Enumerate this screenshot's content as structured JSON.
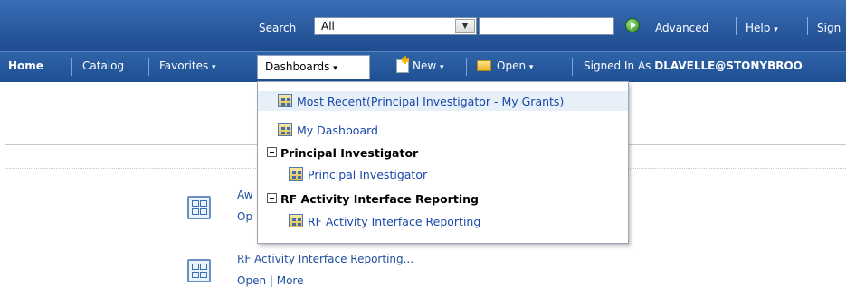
{
  "topbar": {
    "search_label": "Search",
    "search_scope": "All",
    "search_input_value": "",
    "advanced_label": "Advanced",
    "help_label": "Help",
    "sign_label": "Sign"
  },
  "nav": {
    "home": "Home",
    "catalog": "Catalog",
    "favorites": "Favorites",
    "dashboards": "Dashboards",
    "new": "New",
    "open": "Open",
    "signed_in_as": "Signed In As",
    "user": "DLAVELLE@STONYBROO"
  },
  "dashboards_menu": {
    "most_recent": "Most Recent(Principal Investigator - My Grants)",
    "my_dashboard": "My Dashboard",
    "groups": [
      {
        "heading": "Principal Investigator",
        "items": [
          "Principal Investigator"
        ]
      },
      {
        "heading": "RF Activity Interface Reporting",
        "items": [
          "RF Activity Interface Reporting"
        ]
      }
    ]
  },
  "content": {
    "item1_title_partial": "Aw",
    "item1_links_partial": "Op",
    "item2_title": "RF Activity Interface Reporting...",
    "item2_links": "Open | More"
  },
  "icons": {
    "go": "go-arrow-icon",
    "dashboard": "dashboard-icon",
    "new": "new-icon",
    "open": "folder-icon",
    "dropdown": "chevron-down-icon",
    "collapse": "collapse-minus-icon"
  },
  "colors": {
    "topbar": "#2a5aa0",
    "navbar": "#1f4f93",
    "link": "#1a48a8",
    "menu_highlight": "#e7eff9"
  }
}
